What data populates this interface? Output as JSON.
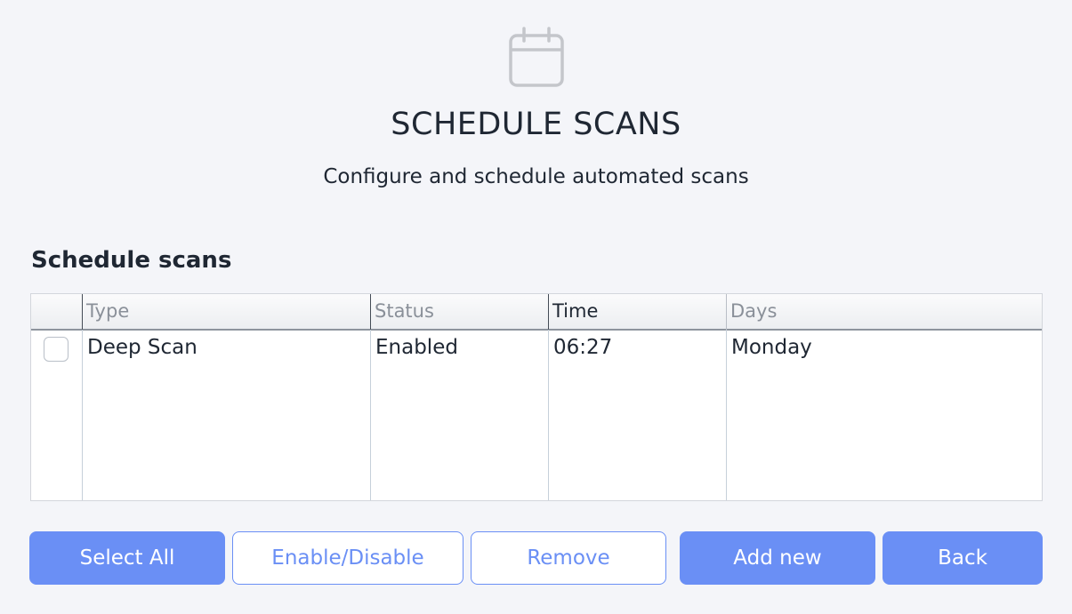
{
  "header": {
    "icon": "calendar-icon",
    "title": "SCHEDULE SCANS",
    "subtitle": "Configure and schedule automated scans"
  },
  "section": {
    "title": "Schedule scans"
  },
  "table": {
    "columns": [
      "Type",
      "Status",
      "Time",
      "Days"
    ],
    "rows": [
      {
        "checked": false,
        "type": "Deep Scan",
        "status": "Enabled",
        "time": "06:27",
        "days": "Monday"
      }
    ]
  },
  "buttons": {
    "select_all": "Select All",
    "enable_disable": "Enable/Disable",
    "remove": "Remove",
    "add_new": "Add new",
    "back": "Back"
  },
  "colors": {
    "accent": "#6a8ff5",
    "background": "#f4f5f9",
    "text": "#1f2733",
    "icon": "#c4c6cb"
  }
}
